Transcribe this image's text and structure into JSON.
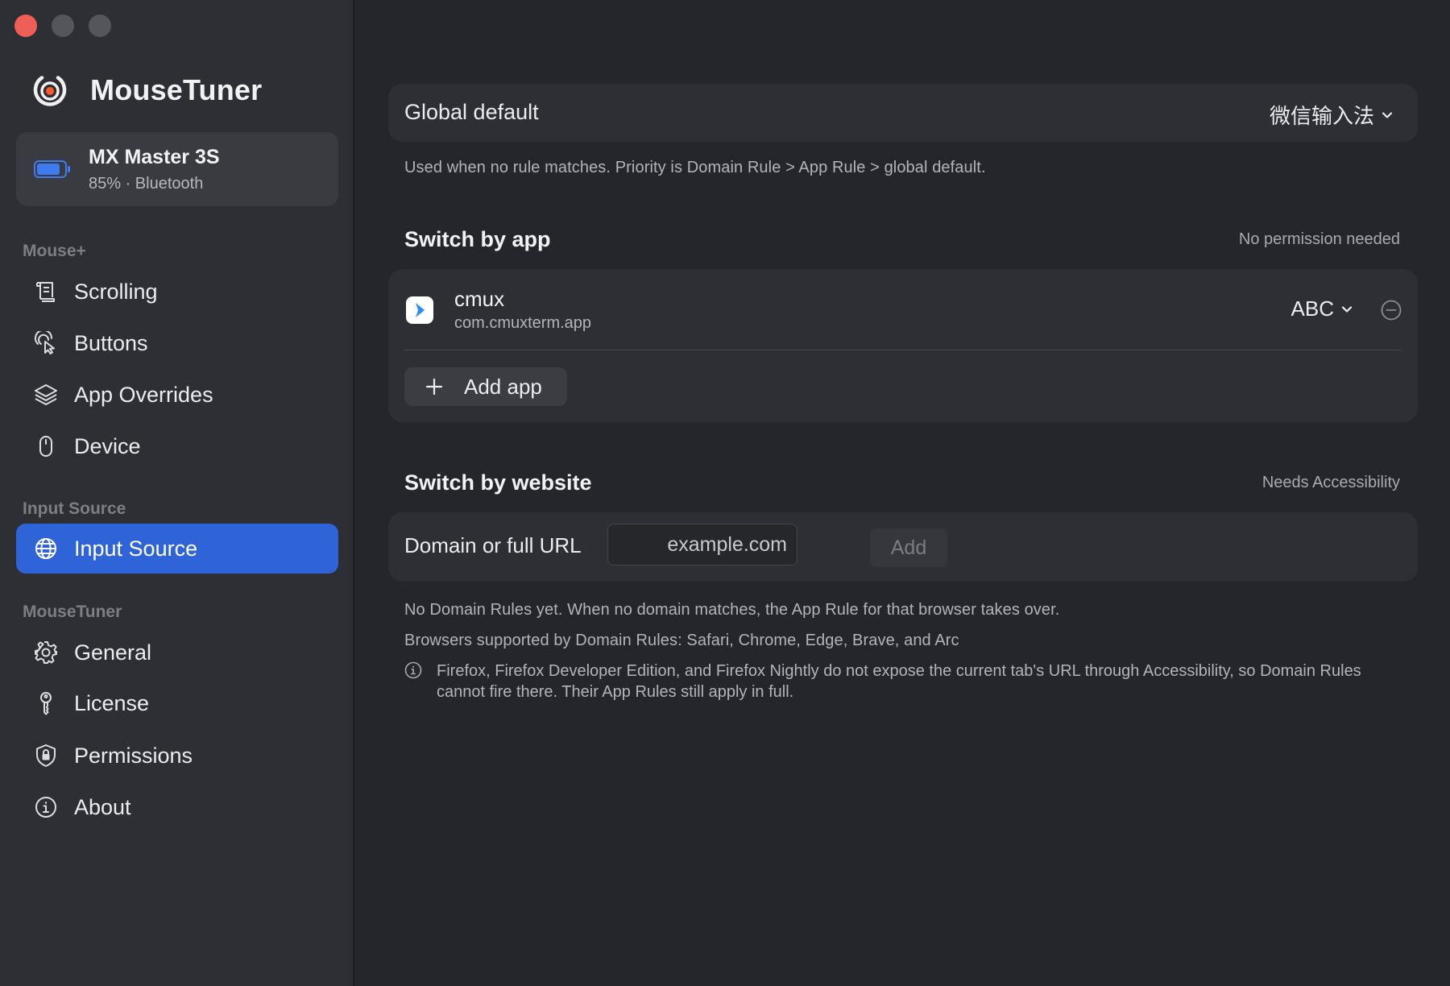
{
  "app": {
    "title": "MouseTuner"
  },
  "device": {
    "name": "MX Master 3S",
    "status": "85% · Bluetooth",
    "battery_percent": 85
  },
  "sidebar": {
    "sections": [
      {
        "label": "Mouse+",
        "items": [
          {
            "label": "Scrolling",
            "icon": "scroll-icon"
          },
          {
            "label": "Buttons",
            "icon": "pointer-click-icon"
          },
          {
            "label": "App Overrides",
            "icon": "layers-icon"
          },
          {
            "label": "Device",
            "icon": "mouse-icon"
          }
        ]
      },
      {
        "label": "Input Source",
        "items": [
          {
            "label": "Input Source",
            "icon": "globe-icon",
            "active": true
          }
        ]
      },
      {
        "label": "MouseTuner",
        "items": [
          {
            "label": "General",
            "icon": "gear-icon"
          },
          {
            "label": "License",
            "icon": "key-icon"
          },
          {
            "label": "Permissions",
            "icon": "shield-lock-icon"
          },
          {
            "label": "About",
            "icon": "info-icon"
          }
        ]
      }
    ]
  },
  "global_default": {
    "label": "Global default",
    "value": "微信输入法",
    "help": "Used when no rule matches. Priority is Domain Rule > App Rule > global default."
  },
  "switch_by_app": {
    "title": "Switch by app",
    "note": "No permission needed",
    "apps": [
      {
        "name": "cmux",
        "bundle": "com.cmuxterm.app",
        "input_source": "ABC"
      }
    ],
    "add_label": "Add app"
  },
  "switch_by_website": {
    "title": "Switch by website",
    "note": "Needs Accessibility",
    "field_label": "Domain or full URL",
    "placeholder": "example.com",
    "add_label": "Add",
    "empty_text": "No Domain Rules yet. When no domain matches, the App Rule for that browser takes over.",
    "supported_text": "Browsers supported by Domain Rules: Safari, Chrome, Edge, Brave, and Arc",
    "info_text": "Firefox, Firefox Developer Edition, and Firefox Nightly do not expose the current tab's URL through Accessibility, so Domain Rules cannot fire there. Their App Rules still apply in full."
  },
  "colors": {
    "accent": "#2f63d8",
    "background": "#25262b",
    "sidebar": "#2e2f34",
    "card": "#2e2f34",
    "close": "#ee5f57",
    "brand": "#ff5a2c"
  }
}
